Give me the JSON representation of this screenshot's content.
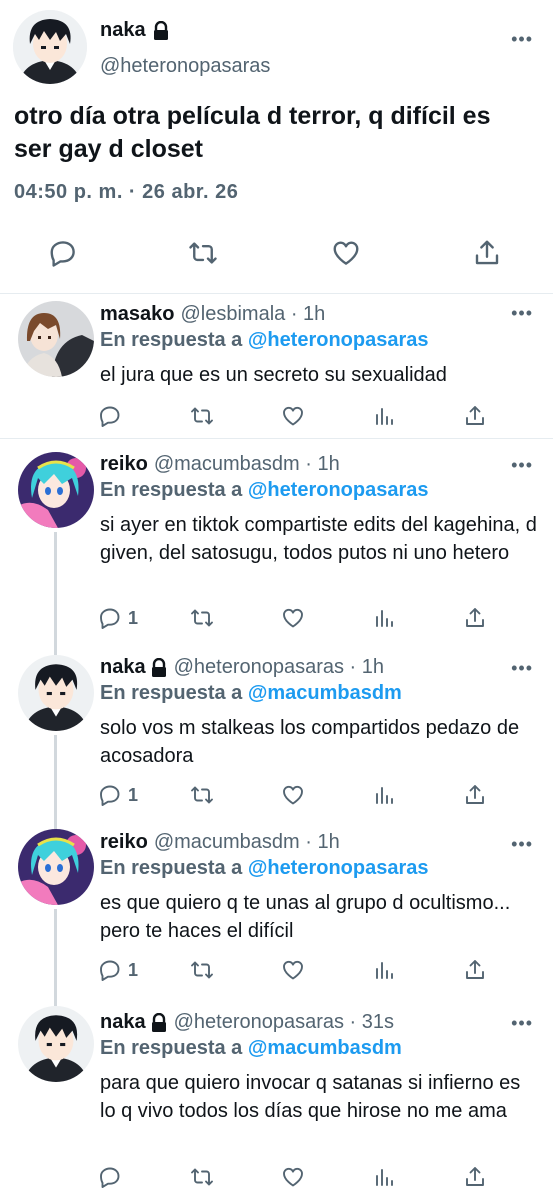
{
  "main_tweet": {
    "name": "naka",
    "handle": "@heteronopasaras",
    "text": "otro día otra película d terror, q difícil es ser gay d closet",
    "meta": "04:50 p. m. · 26 abr. 26",
    "more": "•••"
  },
  "replies": [
    {
      "name": "masako",
      "handle": "@lesbimala · 1h",
      "reply_prefix": "En respuesta a ",
      "reply_to": "@heteronopasaras",
      "text": "el jura que es un secreto su sexualidad",
      "reply_count": "",
      "more": "•••"
    },
    {
      "name": "reiko",
      "handle": "@macumbasdm · 1h",
      "reply_prefix": "En respuesta a ",
      "reply_to": "@heteronopasaras",
      "text": "si ayer en tiktok compartiste edits del kagehina, d given, del satosugu, todos putos ni uno hetero",
      "reply_count": "1",
      "more": "•••"
    },
    {
      "name": "naka",
      "handle": "@heteronopasaras · 1h",
      "reply_prefix": "En respuesta a ",
      "reply_to": "@macumbasdm",
      "text": "solo vos m stalkeas los compartidos pedazo de acosadora",
      "reply_count": "1",
      "more": "•••"
    },
    {
      "name": "reiko",
      "handle": "@macumbasdm · 1h",
      "reply_prefix": "En respuesta a ",
      "reply_to": "@heteronopasaras",
      "text": "es que quiero q te unas al grupo d ocultismo... pero te haces el difícil",
      "reply_count": "1",
      "more": "•••"
    },
    {
      "name": "naka",
      "handle": "@heteronopasaras · 31s",
      "reply_prefix": "En respuesta a ",
      "reply_to": "@macumbasdm",
      "text": "para que quiero invocar q satanas si infierno es lo q vivo todos los días que hirose no me ama",
      "reply_count": "",
      "more": "•••"
    }
  ],
  "colors": {
    "link": "#1d9bf0",
    "muted": "#536471",
    "text": "#0f1419",
    "divider": "#e6ecf0"
  },
  "icons": [
    "reply-icon",
    "retweet-icon",
    "like-icon",
    "views-icon",
    "share-icon",
    "lock-icon",
    "more-icon"
  ]
}
